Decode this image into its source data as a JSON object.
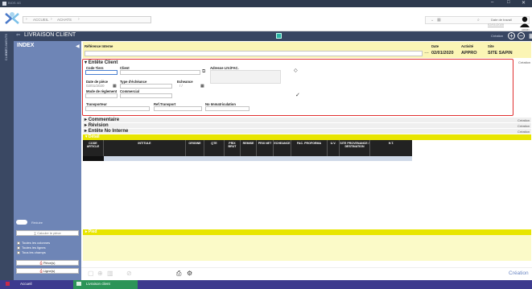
{
  "window": {
    "app_icon_label": "BIOS 4G",
    "controls": [
      "–",
      "□",
      "✕"
    ]
  },
  "topbar": {
    "breadcrumb": [
      "ACCUEIL",
      "ACHATS"
    ],
    "date_label": "Date de travail",
    "date_value": "02/01/2020",
    "user_label": "ADMIN"
  },
  "page": {
    "title": "LIVRAISON CLIENT",
    "creation_label": "Création"
  },
  "side_strip": {
    "labels": [
      "DOCUMENTS",
      "CLIENT"
    ]
  },
  "index": {
    "title": "INDEX",
    "toggle_label": "Réduire",
    "calc_button": "Calculer le pièce",
    "checks": [
      "Toutes les colonnes",
      "Toutes les lignes",
      "Tous les champs"
    ],
    "btn_pieces": "Pièce(s)",
    "btn_lignes": "Ligne(s)"
  },
  "header": {
    "ref_label": "Référence Interne",
    "ref_value": "",
    "date_label": "Date",
    "date_value": "02/01/2020",
    "activite_label": "Activité",
    "activite_value": "APPRO",
    "site_label": "Site",
    "site_value": "SITE SAPIN"
  },
  "entete": {
    "title": "Entête Client",
    "creation": "Création",
    "code_tiers": "Code Tiers",
    "client": "Client",
    "adresse": "Adresse LIV./FAC.",
    "date_piece": "Date de pièce",
    "date_piece_value": "02/01/2020",
    "type_echeance": "Type d'échéance",
    "echeance": "Echeance",
    "echeance_value": "/ /",
    "mode_reglement": "Mode de règlement",
    "commercial": "Commercial",
    "transporteur": "Transporteur",
    "ref_transport": "Ref.Transport",
    "immat": "No Immatriculation"
  },
  "sections": [
    {
      "title": "Commentaire",
      "creation": "Création"
    },
    {
      "title": "Révision",
      "creation": "Création"
    },
    {
      "title": "Entête No Interne",
      "creation": "Création"
    }
  ],
  "detail": {
    "title": "Détail",
    "columns": [
      "CODE ARTICLE",
      "INTITULE",
      "ORIGINE",
      "QTE",
      "PRIX BRUT",
      "REMISE",
      "PRIX NET",
      "ECHEANCE",
      "FAC. PROFORMA",
      "U.V.",
      "SITE PROVENANCE / DESTINATION",
      "H.T."
    ]
  },
  "pied": {
    "title": "Pied"
  },
  "footer": {
    "creation": "Création"
  },
  "statusbar": {
    "accueil": "Accueil",
    "livraison": "Livraison client"
  }
}
